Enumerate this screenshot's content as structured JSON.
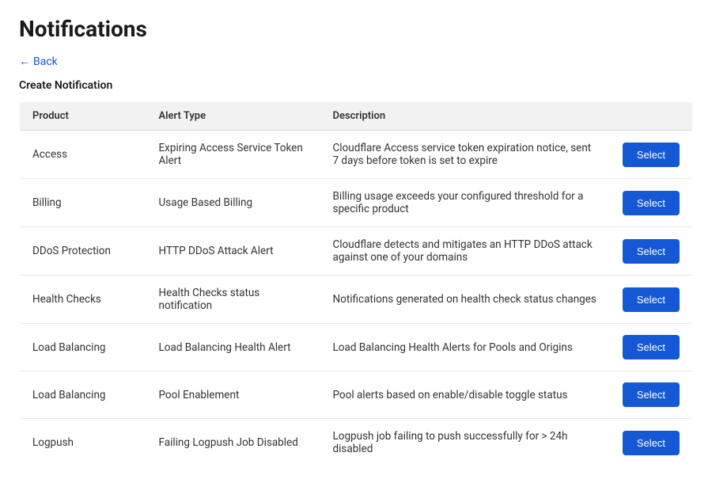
{
  "page": {
    "title": "Notifications",
    "back_label": "Back",
    "section_label": "Create Notification"
  },
  "table": {
    "columns": [
      {
        "key": "product",
        "label": "Product"
      },
      {
        "key": "alert_type",
        "label": "Alert Type"
      },
      {
        "key": "description",
        "label": "Description"
      },
      {
        "key": "action",
        "label": ""
      }
    ],
    "rows": [
      {
        "product": "Access",
        "alert_type": "Expiring Access Service Token Alert",
        "description": "Cloudflare Access service token expiration notice, sent 7 days before token is set to expire",
        "button_label": "Select"
      },
      {
        "product": "Billing",
        "alert_type": "Usage Based Billing",
        "description": "Billing usage exceeds your configured threshold for a specific product",
        "button_label": "Select"
      },
      {
        "product": "DDoS Protection",
        "alert_type": "HTTP DDoS Attack Alert",
        "description": "Cloudflare detects and mitigates an HTTP DDoS attack against one of your domains",
        "button_label": "Select"
      },
      {
        "product": "Health Checks",
        "alert_type": "Health Checks status notification",
        "description": "Notifications generated on health check status changes",
        "button_label": "Select"
      },
      {
        "product": "Load Balancing",
        "alert_type": "Load Balancing Health Alert",
        "description": "Load Balancing Health Alerts for Pools and Origins",
        "button_label": "Select"
      },
      {
        "product": "Load Balancing",
        "alert_type": "Pool Enablement",
        "description": "Pool alerts based on enable/disable toggle status",
        "button_label": "Select"
      },
      {
        "product": "Logpush",
        "alert_type": "Failing Logpush Job Disabled",
        "description": "Logpush job failing to push successfully for > 24h disabled",
        "button_label": "Select"
      }
    ]
  }
}
